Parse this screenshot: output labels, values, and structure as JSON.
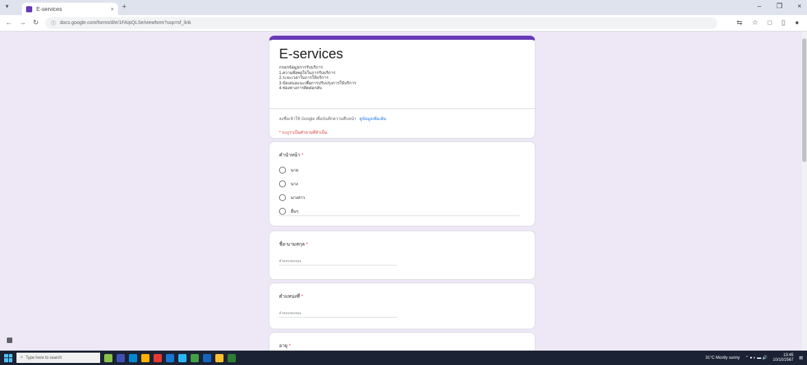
{
  "browser": {
    "tab_title": "E-services",
    "tab_close": "×",
    "new_tab": "+",
    "url": "docs.google.com/forms/d/e/1FAIpQLSe/viewform?usp=sf_link",
    "win_minimize": "–",
    "win_maximize": "❐",
    "win_close": "×"
  },
  "form": {
    "title": "E-services",
    "description_lines": [
      "กรอกข้อมูลการรับบริการ",
      "1.ความพึงพอใจในการรับบริการ",
      "2.ระยะเวลาในการให้บริการ",
      "3.ข้อเสนอแนะเพื่อการปรับปรุงการให้บริการ",
      "4.ช่องทางการติดต่อกลับ"
    ],
    "signin_text": "ลงชื่อเข้าใช้ Google เพื่อบันทึกความคืบหน้า",
    "signin_link": "ดูข้อมูลเพิ่มเติม",
    "required_note": "* ระบุว่าเป็นคำถามที่จำเป็น"
  },
  "questions": {
    "q1": {
      "title": "คำนำหน้า",
      "options": [
        "นาย",
        "นาง",
        "นางสาว",
        "อื่นๆ"
      ]
    },
    "q2": {
      "title": "ชื่อ-นามสกุล",
      "placeholder": "คำตอบของคุณ"
    },
    "q3": {
      "title": "ตำแหน่งที่",
      "placeholder": "คำตอบของคุณ"
    },
    "q4": {
      "title": "อายุ"
    },
    "required_mark": "*"
  },
  "taskbar": {
    "search_placeholder": "Type here to search",
    "weather": "31°C Mostly sunny",
    "time": "13:45",
    "date": "10/10/2567"
  },
  "colors": {
    "accent": "#673ab7",
    "background": "#ede7f6",
    "required": "#d93025"
  }
}
